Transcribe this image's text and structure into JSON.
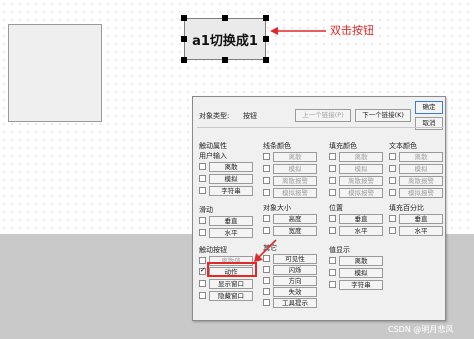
{
  "canvas": {
    "button_text": "a1切换成1",
    "annotation": "双击按钮",
    "annotation_color": "#e0292a",
    "watermark": "CSDN @明月悲风"
  },
  "dialog": {
    "object_type_label": "对象类型:",
    "object_type_value": "按钮",
    "prev_link": "上一个链接(P)",
    "next_link": "下一个链接(K)",
    "ok": "确定",
    "cancel": "取消",
    "groups": {
      "touch_link": {
        "title": "触动属性",
        "subtitle": "用户输入",
        "items": [
          "离散",
          "模拟",
          "字符串"
        ]
      },
      "line_color": {
        "title": "线条颜色",
        "items": [
          "离散",
          "模拟",
          "离散报警",
          "模拟报警"
        ]
      },
      "fill_color": {
        "title": "填充颜色",
        "items": [
          "离散",
          "模拟",
          "离散报警",
          "模拟报警"
        ]
      },
      "text_color": {
        "title": "文本颜色",
        "items": [
          "离散",
          "模拟",
          "离散报警",
          "模拟报警"
        ]
      },
      "slider": {
        "title": "滑动",
        "items": [
          "垂直",
          "水平"
        ]
      },
      "object_size": {
        "title": "对象大小",
        "items": [
          "高度",
          "宽度"
        ]
      },
      "position": {
        "title": "位置",
        "items": [
          "垂直",
          "水平"
        ]
      },
      "fill_percent": {
        "title": "填充百分比",
        "items": [
          "垂直",
          "水平"
        ]
      },
      "touch_button": {
        "title": "触动按钮",
        "items": [
          "离散值",
          "动作",
          "显示窗口",
          "隐藏窗口"
        ],
        "checked_index": 1
      },
      "other": {
        "title": "其它",
        "items": [
          "可见性",
          "闪烁",
          "方向",
          "失效",
          "工具提示"
        ]
      },
      "value_output": {
        "title": "值显示",
        "items": [
          "离散",
          "模拟",
          "字符串"
        ]
      }
    }
  }
}
